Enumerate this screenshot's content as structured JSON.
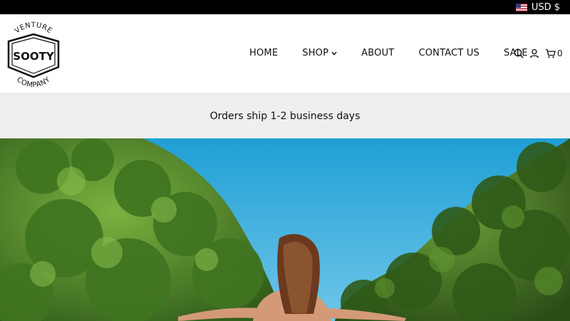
{
  "topbar": {
    "currency_label": "USD $",
    "flag_icon": "us-flag-icon"
  },
  "logo": {
    "top_text": "VENTURE",
    "main_text": "SOOTY",
    "bottom_text": "COMPANY"
  },
  "nav": {
    "items": [
      {
        "label": "HOME"
      },
      {
        "label": "SHOP"
      },
      {
        "label": "ABOUT"
      },
      {
        "label": "CONTACT US"
      },
      {
        "label": "SALE"
      }
    ]
  },
  "header_icons": {
    "search": "search-icon",
    "account": "user-icon",
    "cart": "cart-icon",
    "cart_count": "0"
  },
  "announcement": {
    "text": "Orders ship 1-2 business days"
  },
  "hero": {
    "description_icon": "hero-image",
    "colors": {
      "sky": "#2aa6d8",
      "foliage": "#4f8a2a",
      "hair": "#6b3a1e",
      "skin": "#d59b7a"
    }
  }
}
